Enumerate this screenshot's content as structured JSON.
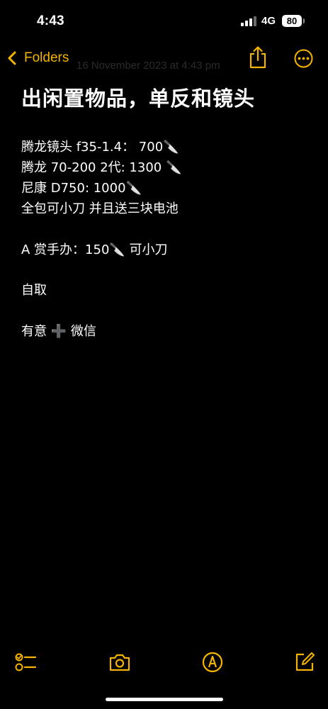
{
  "status_bar": {
    "time": "4:43",
    "network": "4G",
    "battery": "80"
  },
  "nav": {
    "back_label": "Folders",
    "date_hint": "16 November 2023 at 4:43 pm"
  },
  "note": {
    "title": "出闲置物品，单反和镜头",
    "lines": [
      "腾龙镜头 f35-1.4： 700🔪",
      "腾龙 70-200 2代: 1300 🔪",
      "尼康 D750: 1000🔪",
      "全包可小刀 并且送三块电池",
      "A 赏手办：150🔪 可小刀",
      "自取",
      "有意 ➕ 微信"
    ]
  },
  "toolbar": {
    "checklist": "checklist-icon",
    "camera": "camera-icon",
    "markup": "markup-pen-icon",
    "compose": "compose-icon"
  },
  "colors": {
    "accent": "#f4b400",
    "background": "#000000",
    "text": "#ffffff"
  }
}
